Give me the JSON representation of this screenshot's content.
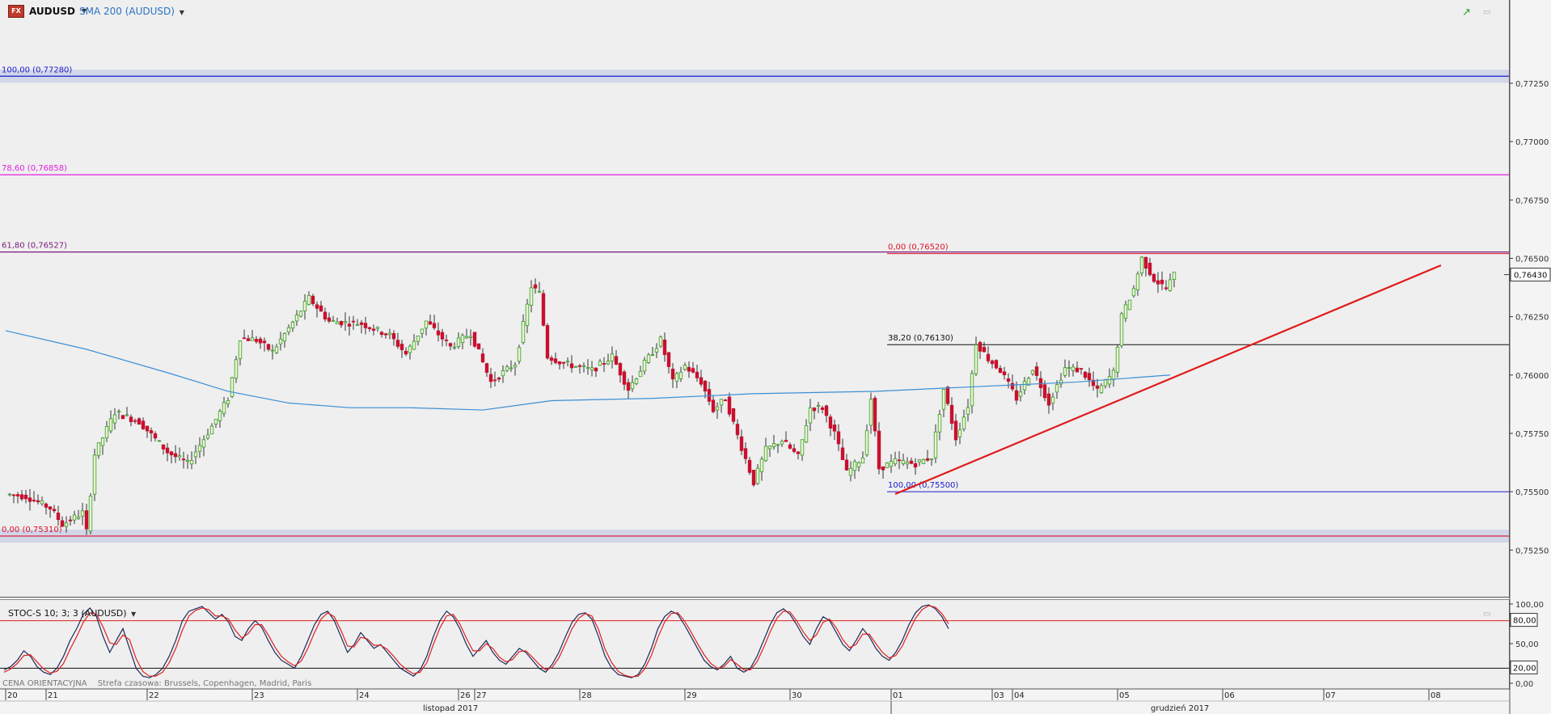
{
  "header": {
    "symbol": "AUDUSD",
    "indicator": "SMA 200 (AUDUSD)"
  },
  "icons": [
    "fx-icon",
    "chart-trend-icon",
    "window-restore-icon"
  ],
  "colors": {
    "bull": "#3c9a2a",
    "bull_fill": "#e8f5d0",
    "bear": "#c8102e",
    "sma": "#3a8fd6",
    "trend": "#e01b1b",
    "fib_100": "#1c1ccc",
    "fib_786": "#e020e0",
    "fib_618": "#7a1a7a",
    "fib_0": "#e0102a",
    "fib_382": "#111111",
    "stoch_k": "#1a2a5a",
    "stoch_d": "#e02020"
  },
  "chart_data": [
    {
      "type": "candlestick",
      "symbol": "AUDUSD",
      "ylim": [
        0.7505,
        0.7752
      ],
      "y_ticks": [
        "0,77250",
        "0,77000",
        "0,76750",
        "0,76500",
        "0,76250",
        "0,76000",
        "0,75750",
        "0,75500",
        "0,75250"
      ],
      "y_tick_values": [
        0.7725,
        0.77,
        0.7675,
        0.765,
        0.7625,
        0.76,
        0.7575,
        0.755,
        0.7525
      ],
      "current_price_label": "0,76430",
      "current_price": 0.7643,
      "x_ticks": [
        {
          "label": "20",
          "i": 0
        },
        {
          "label": "21",
          "i": 10
        },
        {
          "label": "22",
          "i": 35
        },
        {
          "label": "23",
          "i": 61
        },
        {
          "label": "24",
          "i": 87
        },
        {
          "label": "26",
          "i": 112
        },
        {
          "label": "27",
          "i": 116
        },
        {
          "label": "28",
          "i": 142
        },
        {
          "label": "29",
          "i": 168
        },
        {
          "label": "30",
          "i": 194
        },
        {
          "label": "01",
          "i": 219
        },
        {
          "label": "03",
          "i": 244
        },
        {
          "label": "04",
          "i": 249
        },
        {
          "label": "05",
          "i": 275
        },
        {
          "label": "06",
          "i": 301
        },
        {
          "label": "07",
          "i": 326
        },
        {
          "label": "08",
          "i": 352
        }
      ],
      "months": [
        {
          "label": "listopad 2017",
          "i": 110
        },
        {
          "label": "grudzień 2017",
          "i": 290
        }
      ],
      "month_separator_i": 219,
      "fib_set_1": [
        {
          "label": "100,00 (0,77280)",
          "value": 0.7728,
          "color": "#1c1ccc",
          "band": true
        },
        {
          "label": "78,60 (0,76858)",
          "value": 0.76858,
          "color": "#e020e0"
        },
        {
          "label": "61,80 (0,76527)",
          "value": 0.76527,
          "color": "#7a1a7a"
        },
        {
          "label": "0,00 (0,75310)",
          "value": 0.7531,
          "color": "#e0102a",
          "band": true
        }
      ],
      "fib_set_2": [
        {
          "label": "0,00 (0,76520)",
          "value": 0.7652,
          "color": "#e0102a"
        },
        {
          "label": "38,20 (0,76130)",
          "value": 0.7613,
          "color": "#111111"
        },
        {
          "label": "100,00 (0,75500)",
          "value": 0.755,
          "color": "#1c1ccc"
        }
      ],
      "fib_set_2_start_i": 218,
      "trendline": [
        {
          "i": 220,
          "price": 0.7549
        },
        {
          "i": 355,
          "price": 0.7647
        }
      ],
      "sma_path": [
        {
          "i": 0,
          "price": 0.7619
        },
        {
          "i": 20,
          "price": 0.7611
        },
        {
          "i": 40,
          "price": 0.7601
        },
        {
          "i": 55,
          "price": 0.7593
        },
        {
          "i": 70,
          "price": 0.7588
        },
        {
          "i": 85,
          "price": 0.7586
        },
        {
          "i": 100,
          "price": 0.7586
        },
        {
          "i": 118,
          "price": 0.7585
        },
        {
          "i": 135,
          "price": 0.7589
        },
        {
          "i": 160,
          "price": 0.759
        },
        {
          "i": 185,
          "price": 0.7592
        },
        {
          "i": 215,
          "price": 0.7593
        },
        {
          "i": 240,
          "price": 0.7595
        },
        {
          "i": 265,
          "price": 0.7597
        },
        {
          "i": 288,
          "price": 0.76
        }
      ],
      "anchors": [
        {
          "i": 0,
          "price": 0.7549
        },
        {
          "i": 5,
          "price": 0.7548
        },
        {
          "i": 11,
          "price": 0.7543
        },
        {
          "i": 14,
          "price": 0.7536
        },
        {
          "i": 19,
          "price": 0.7541
        },
        {
          "i": 20,
          "price": 0.7533
        },
        {
          "i": 22,
          "price": 0.7566
        },
        {
          "i": 27,
          "price": 0.7584
        },
        {
          "i": 33,
          "price": 0.758
        },
        {
          "i": 40,
          "price": 0.7567
        },
        {
          "i": 45,
          "price": 0.7562
        },
        {
          "i": 51,
          "price": 0.7578
        },
        {
          "i": 55,
          "price": 0.759
        },
        {
          "i": 58,
          "price": 0.7616
        },
        {
          "i": 62,
          "price": 0.7615
        },
        {
          "i": 66,
          "price": 0.761
        },
        {
          "i": 72,
          "price": 0.7625
        },
        {
          "i": 75,
          "price": 0.7633
        },
        {
          "i": 80,
          "price": 0.7623
        },
        {
          "i": 88,
          "price": 0.7622
        },
        {
          "i": 95,
          "price": 0.7617
        },
        {
          "i": 99,
          "price": 0.7609
        },
        {
          "i": 104,
          "price": 0.7623
        },
        {
          "i": 110,
          "price": 0.7612
        },
        {
          "i": 115,
          "price": 0.7618
        },
        {
          "i": 120,
          "price": 0.7597
        },
        {
          "i": 126,
          "price": 0.7605
        },
        {
          "i": 130,
          "price": 0.7638
        },
        {
          "i": 132,
          "price": 0.7635
        },
        {
          "i": 134,
          "price": 0.7608
        },
        {
          "i": 138,
          "price": 0.7605
        },
        {
          "i": 145,
          "price": 0.7602
        },
        {
          "i": 150,
          "price": 0.7608
        },
        {
          "i": 154,
          "price": 0.7594
        },
        {
          "i": 158,
          "price": 0.7605
        },
        {
          "i": 162,
          "price": 0.7615
        },
        {
          "i": 165,
          "price": 0.7597
        },
        {
          "i": 168,
          "price": 0.7604
        },
        {
          "i": 172,
          "price": 0.7597
        },
        {
          "i": 175,
          "price": 0.7585
        },
        {
          "i": 178,
          "price": 0.759
        },
        {
          "i": 181,
          "price": 0.7574
        },
        {
          "i": 185,
          "price": 0.7554
        },
        {
          "i": 188,
          "price": 0.7568
        },
        {
          "i": 192,
          "price": 0.7572
        },
        {
          "i": 196,
          "price": 0.7565
        },
        {
          "i": 199,
          "price": 0.7586
        },
        {
          "i": 202,
          "price": 0.7586
        },
        {
          "i": 205,
          "price": 0.7575
        },
        {
          "i": 208,
          "price": 0.7558
        },
        {
          "i": 212,
          "price": 0.7565
        },
        {
          "i": 214,
          "price": 0.759
        },
        {
          "i": 216,
          "price": 0.756
        },
        {
          "i": 220,
          "price": 0.7563
        },
        {
          "i": 225,
          "price": 0.7562
        },
        {
          "i": 229,
          "price": 0.7565
        },
        {
          "i": 232,
          "price": 0.7594
        },
        {
          "i": 235,
          "price": 0.7573
        },
        {
          "i": 238,
          "price": 0.7587
        },
        {
          "i": 240,
          "price": 0.7614
        },
        {
          "i": 243,
          "price": 0.7607
        },
        {
          "i": 246,
          "price": 0.7602
        },
        {
          "i": 250,
          "price": 0.759
        },
        {
          "i": 254,
          "price": 0.7603
        },
        {
          "i": 258,
          "price": 0.7588
        },
        {
          "i": 262,
          "price": 0.7603
        },
        {
          "i": 266,
          "price": 0.7602
        },
        {
          "i": 270,
          "price": 0.7593
        },
        {
          "i": 274,
          "price": 0.7601
        },
        {
          "i": 276,
          "price": 0.7625
        },
        {
          "i": 279,
          "price": 0.7637
        },
        {
          "i": 281,
          "price": 0.765
        },
        {
          "i": 284,
          "price": 0.7641
        },
        {
          "i": 287,
          "price": 0.7637
        },
        {
          "i": 289,
          "price": 0.7643
        }
      ]
    },
    {
      "type": "line",
      "title": "STOC-S 10; 3; 3 (AUDUSD)",
      "ylim": [
        0,
        100
      ],
      "y_ticks": [
        "100,00",
        "50,00",
        "0,00"
      ],
      "y_tick_values": [
        100,
        50,
        0
      ],
      "levels": [
        {
          "label": "80,00",
          "value": 80
        },
        {
          "label": "20,00",
          "value": 20
        }
      ],
      "series": [
        {
          "values": [
            18,
            22,
            30,
            42,
            35,
            22,
            15,
            12,
            20,
            35,
            55,
            70,
            88,
            96,
            85,
            60,
            40,
            55,
            70,
            45,
            20,
            10,
            8,
            12,
            20,
            35,
            55,
            80,
            92,
            95,
            98,
            90,
            82,
            88,
            78,
            60,
            55,
            70,
            80,
            72,
            55,
            40,
            30,
            25,
            20,
            35,
            55,
            75,
            88,
            92,
            80,
            60,
            40,
            50,
            65,
            55,
            45,
            50,
            40,
            30,
            20,
            15,
            10,
            18,
            35,
            60,
            80,
            92,
            85,
            70,
            50,
            35,
            45,
            55,
            40,
            30,
            25,
            35,
            45,
            40,
            30,
            20,
            15,
            25,
            40,
            60,
            78,
            88,
            90,
            82,
            60,
            35,
            20,
            12,
            10,
            8,
            12,
            25,
            45,
            70,
            85,
            92,
            88,
            75,
            60,
            45,
            30,
            22,
            18,
            25,
            35,
            20,
            15,
            20,
            35,
            55,
            75,
            90,
            95,
            88,
            75,
            60,
            50,
            70,
            85,
            80,
            65,
            50,
            42,
            55,
            70,
            60,
            45,
            35,
            30,
            40,
            55,
            75,
            90,
            98,
            100,
            95,
            85,
            70
          ]
        },
        {
          "values": [
            15,
            19,
            26,
            36,
            37,
            28,
            19,
            14,
            16,
            26,
            44,
            60,
            78,
            90,
            88,
            72,
            52,
            50,
            62,
            56,
            32,
            16,
            10,
            10,
            15,
            27,
            45,
            68,
            86,
            93,
            96,
            94,
            86,
            86,
            82,
            68,
            58,
            64,
            75,
            75,
            62,
            47,
            35,
            28,
            23,
            29,
            45,
            65,
            82,
            90,
            85,
            68,
            48,
            47,
            59,
            57,
            49,
            49,
            44,
            35,
            25,
            18,
            13,
            15,
            27,
            50,
            71,
            86,
            88,
            76,
            58,
            42,
            42,
            51,
            45,
            34,
            28,
            31,
            41,
            42,
            34,
            25,
            18,
            21,
            33,
            51,
            70,
            83,
            89,
            86,
            69,
            44,
            27,
            16,
            11,
            9,
            10,
            19,
            36,
            59,
            78,
            89,
            90,
            80,
            66,
            51,
            37,
            26,
            20,
            22,
            31,
            25,
            18,
            18,
            28,
            46,
            66,
            83,
            92,
            91,
            80,
            66,
            55,
            62,
            78,
            82,
            71,
            56,
            46,
            50,
            63,
            63,
            51,
            40,
            33,
            36,
            48,
            66,
            83,
            94,
            99,
            97,
            89,
            76
          ]
        }
      ]
    }
  ],
  "footer": {
    "price_type": "CENA ORIENTACYJNA",
    "timezone": "Strefa czasowa: Brussels, Copenhagen, Madrid, Paris"
  }
}
